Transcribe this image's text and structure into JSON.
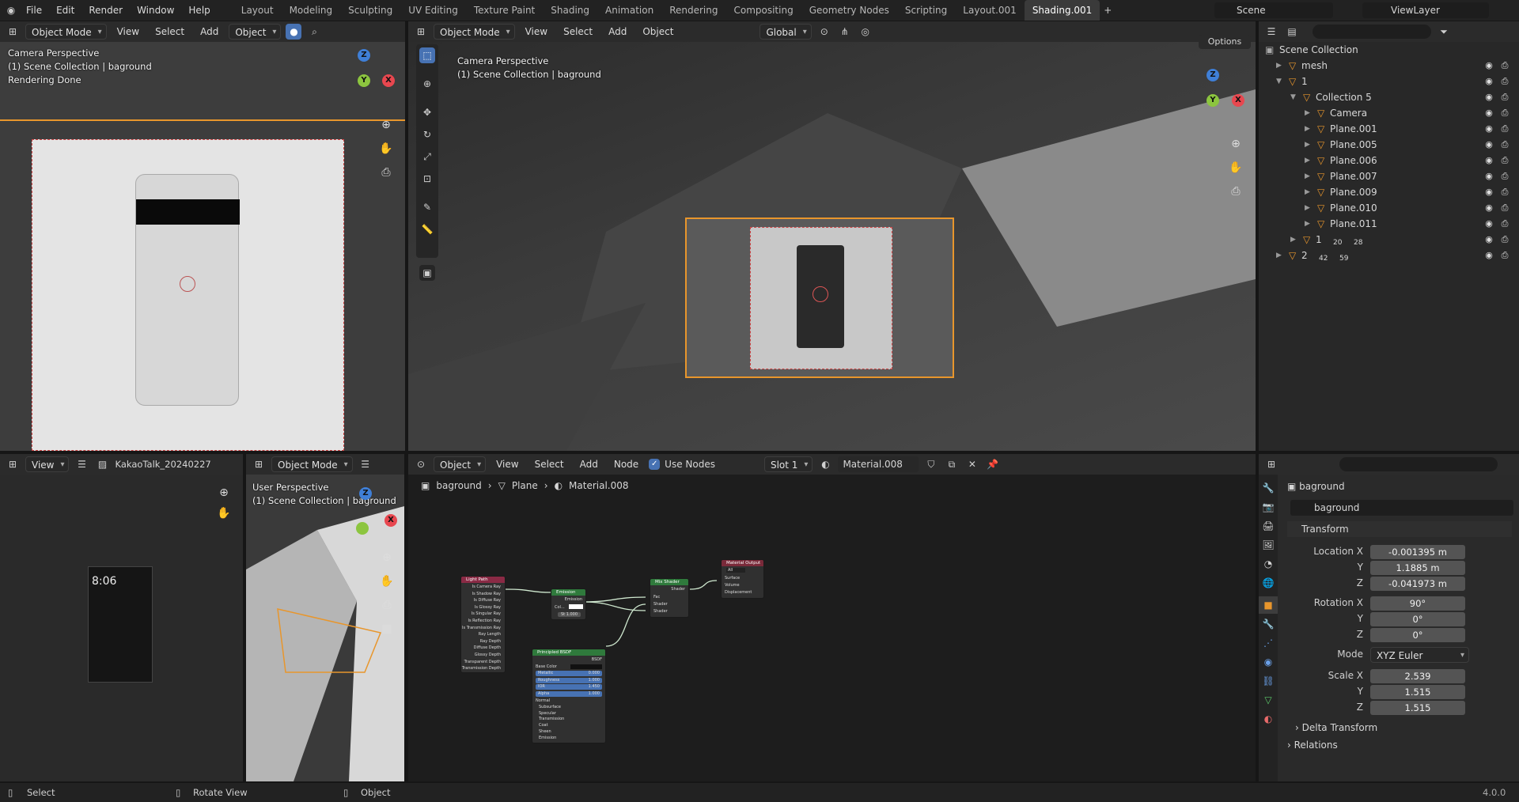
{
  "topbar": {
    "menus": [
      "File",
      "Edit",
      "Render",
      "Window",
      "Help"
    ],
    "workspaces": [
      "Layout",
      "Modeling",
      "Sculpting",
      "UV Editing",
      "Texture Paint",
      "Shading",
      "Animation",
      "Rendering",
      "Compositing",
      "Geometry Nodes",
      "Scripting",
      "Layout.001",
      "Shading.001"
    ],
    "active_workspace": "Shading.001",
    "scene": "Scene",
    "view_layer": "ViewLayer"
  },
  "camera_view": {
    "mode": "Object Mode",
    "menus": [
      "View",
      "Select",
      "Add",
      "Object"
    ],
    "overlay_lines": [
      "Camera Perspective",
      "(1) Scene Collection | baground",
      "Rendering Done"
    ]
  },
  "main_view": {
    "mode": "Object Mode",
    "menus": [
      "View",
      "Select",
      "Add",
      "Object"
    ],
    "transform": "Global",
    "options_label": "Options",
    "overlay_lines": [
      "Camera Perspective",
      "(1) Scene Collection | baground"
    ]
  },
  "outliner": {
    "root": "Scene Collection",
    "rows": [
      {
        "name": "mesh",
        "indent": 1,
        "expanded": false
      },
      {
        "name": "1",
        "indent": 1,
        "expanded": true
      },
      {
        "name": "Collection 5",
        "indent": 2,
        "expanded": true
      },
      {
        "name": "Camera",
        "indent": 3
      },
      {
        "name": "Plane.001",
        "indent": 3
      },
      {
        "name": "Plane.005",
        "indent": 3
      },
      {
        "name": "Plane.006",
        "indent": 3
      },
      {
        "name": "Plane.007",
        "indent": 3
      },
      {
        "name": "Plane.009",
        "indent": 3
      },
      {
        "name": "Plane.010",
        "indent": 3
      },
      {
        "name": "Plane.011",
        "indent": 3
      },
      {
        "name": "1",
        "indent": 2,
        "badges": [
          "20",
          "28"
        ]
      },
      {
        "name": "2",
        "indent": 1,
        "badges": [
          "42",
          "59"
        ]
      }
    ]
  },
  "image_editor": {
    "view_label": "View",
    "image_name": "KakaoTalk_20240227",
    "phone_time": "8:06"
  },
  "user_view": {
    "mode": "Object Mode",
    "overlay_lines": [
      "User Perspective",
      "(1) Scene Collection | baground"
    ]
  },
  "node_editor": {
    "object_label": "Object",
    "menus": [
      "View",
      "Select",
      "Add",
      "Node"
    ],
    "use_nodes_label": "Use Nodes",
    "slot": "Slot 1",
    "material": "Material.008",
    "breadcrumb": [
      "baground",
      "Plane",
      "Material.008"
    ],
    "nodes": {
      "light_path": {
        "title": "Light Path",
        "outputs": [
          "Is Camera Ray",
          "Is Shadow Ray",
          "Is Diffuse Ray",
          "Is Glossy Ray",
          "Is Singular Ray",
          "Is Reflection Ray",
          "Is Transmission Ray",
          "Ray Length",
          "Ray Depth",
          "Diffuse Depth",
          "Glossy Depth",
          "Transparent Depth",
          "Transmission Depth"
        ]
      },
      "emission": {
        "title": "Emission",
        "output": "Emission",
        "color_label": "Col...",
        "strength": "St 1.000"
      },
      "principled": {
        "title": "Principled BSDF",
        "output": "BSDF",
        "base_color": "Base Color",
        "fields": [
          [
            "Metallic",
            "0.000"
          ],
          [
            "Roughness",
            "1.000"
          ],
          [
            "IOR",
            "1.450"
          ],
          [
            "Alpha",
            "1.000"
          ]
        ],
        "sections": [
          "Normal",
          "Subsurface",
          "Specular",
          "Transmission",
          "Coat",
          "Sheen",
          "Emission"
        ]
      },
      "mix_shader": {
        "title": "Mix Shader",
        "output": "Shader",
        "inputs": [
          "Fac",
          "Shader",
          "Shader"
        ]
      },
      "output": {
        "title": "Material Output",
        "target": "All",
        "inputs": [
          "Surface",
          "Volume",
          "Displacement"
        ]
      }
    }
  },
  "properties": {
    "object_name": "baground",
    "data_name": "baground",
    "transform_label": "Transform",
    "location": {
      "label": "Location X",
      "x": "-0.001395 m",
      "y": "1.1885 m",
      "z": "-0.041973 m"
    },
    "rotation": {
      "label": "Rotation X",
      "x": "90°",
      "y": "0°",
      "z": "0°"
    },
    "mode_label": "Mode",
    "mode_value": "XYZ Euler",
    "scale": {
      "label": "Scale X",
      "x": "2.539",
      "y": "1.515",
      "z": "1.515"
    },
    "axis_y": "Y",
    "axis_z": "Z",
    "delta_label": "Delta Transform",
    "relations_label": "Relations"
  },
  "statusbar": {
    "items": [
      "Select",
      "Rotate View",
      "Object"
    ],
    "version": "4.0.0"
  },
  "colors": {
    "accent": "#4772b3",
    "selection_orange": "#e8962c",
    "x_axis": "#e8474f",
    "y_axis": "#8cc53f",
    "z_axis": "#3f7fd7"
  }
}
